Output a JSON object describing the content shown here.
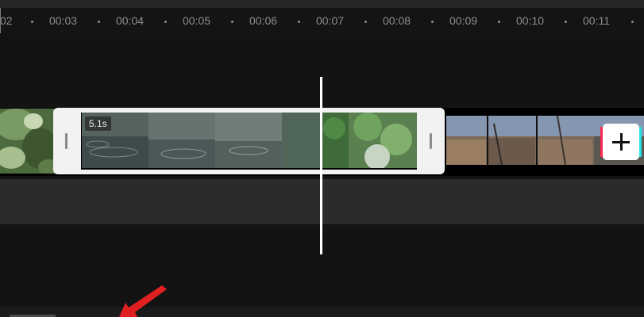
{
  "timeline": {
    "ruler_ticks": [
      "02",
      "00:03",
      "00:04",
      "00:05",
      "00:06",
      "00:07",
      "00:08",
      "00:09",
      "00:10",
      "00:11"
    ],
    "playhead_position": "00:07"
  },
  "selected_clip": {
    "duration_label": "5.1s"
  },
  "add_clip_button": {
    "label": "+"
  },
  "colors": {
    "background": "#121212",
    "selection_frame": "#f2f2f2",
    "playhead": "#ffffff",
    "annotation_arrow": "#e02020",
    "add_button_accent_left": "#ff2a55",
    "add_button_accent_right": "#27e0e6"
  },
  "icons": [
    "trim-handle-left-icon",
    "trim-handle-right-icon",
    "plus-icon",
    "annotation-arrow-icon"
  ]
}
